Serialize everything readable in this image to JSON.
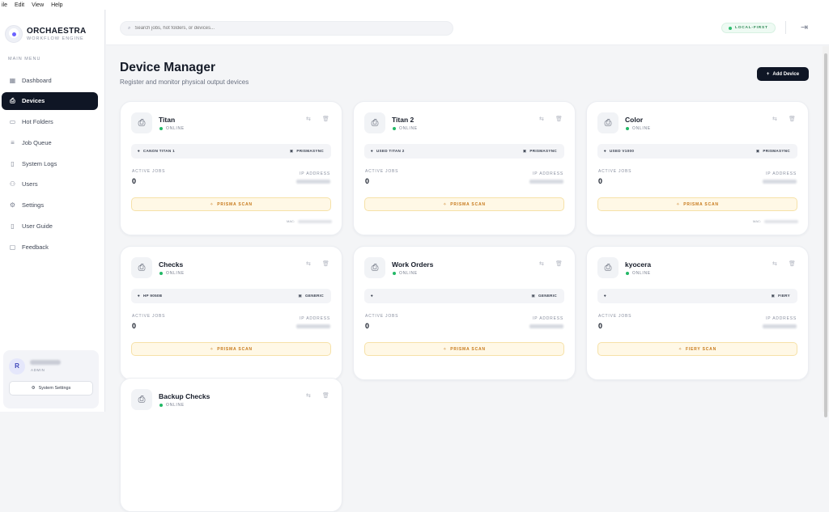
{
  "menubar": [
    "ile",
    "Edit",
    "View",
    "Help"
  ],
  "brand": {
    "name": "ORCHAESTRA",
    "subtitle": "WORKFLOW ENGINE"
  },
  "sidebar": {
    "section_label": "MAIN MENU",
    "items": [
      {
        "label": "Dashboard",
        "icon": "grid-icon",
        "active": false
      },
      {
        "label": "Devices",
        "icon": "printer-icon",
        "active": true
      },
      {
        "label": "Hot Folders",
        "icon": "folder-icon",
        "active": false
      },
      {
        "label": "Job Queue",
        "icon": "list-icon",
        "active": false
      },
      {
        "label": "System Logs",
        "icon": "book-icon",
        "active": false
      },
      {
        "label": "Users",
        "icon": "users-icon",
        "active": false
      },
      {
        "label": "Settings",
        "icon": "gear-icon",
        "active": false
      },
      {
        "label": "User Guide",
        "icon": "book-open-icon",
        "active": false
      },
      {
        "label": "Feedback",
        "icon": "chat-icon",
        "active": false
      }
    ]
  },
  "user": {
    "initial": "R",
    "role": "ADMIN",
    "settings_label": "System Settings"
  },
  "header": {
    "search_placeholder": "Search jobs, hot folders, or devices...",
    "mode_badge": "LOCAL-FIRST"
  },
  "page": {
    "title": "Device Manager",
    "subtitle": "Register and monitor physical output devices",
    "add_button": "Add Device"
  },
  "labels": {
    "active_jobs": "ACTIVE JOBS",
    "ip_address": "IP ADDRESS",
    "mac": "MAC:"
  },
  "devices": [
    {
      "name": "Titan",
      "status": "ONLINE",
      "model": "CANON TITAN 1",
      "system": "PRISMASYNC",
      "active_jobs": "0",
      "scan": "PRISMA SCAN",
      "show_mac": true
    },
    {
      "name": "Titan 2",
      "status": "ONLINE",
      "model": "USED TITAN 2",
      "system": "PRISMASYNC",
      "active_jobs": "0",
      "scan": "PRISMA SCAN",
      "show_mac": false
    },
    {
      "name": "Color",
      "status": "ONLINE",
      "model": "USED V1000",
      "system": "PRISMASYNC",
      "active_jobs": "0",
      "scan": "PRISMA SCAN",
      "show_mac": true
    },
    {
      "name": "Checks",
      "status": "ONLINE",
      "model": "HP 9050B",
      "system": "GENERIC",
      "active_jobs": "0",
      "scan": "PRISMA SCAN",
      "show_mac": false
    },
    {
      "name": "Work Orders",
      "status": "ONLINE",
      "model": "",
      "system": "GENERIC",
      "active_jobs": "0",
      "scan": "PRISMA SCAN",
      "show_mac": false
    },
    {
      "name": "kyocera",
      "status": "ONLINE",
      "model": "",
      "system": "FIERY",
      "active_jobs": "0",
      "scan": "FIERY SCAN",
      "show_mac": false
    },
    {
      "name": "Backup Checks",
      "status": "ONLINE",
      "model": "",
      "system": "",
      "active_jobs": "",
      "scan": "",
      "show_mac": false
    }
  ]
}
